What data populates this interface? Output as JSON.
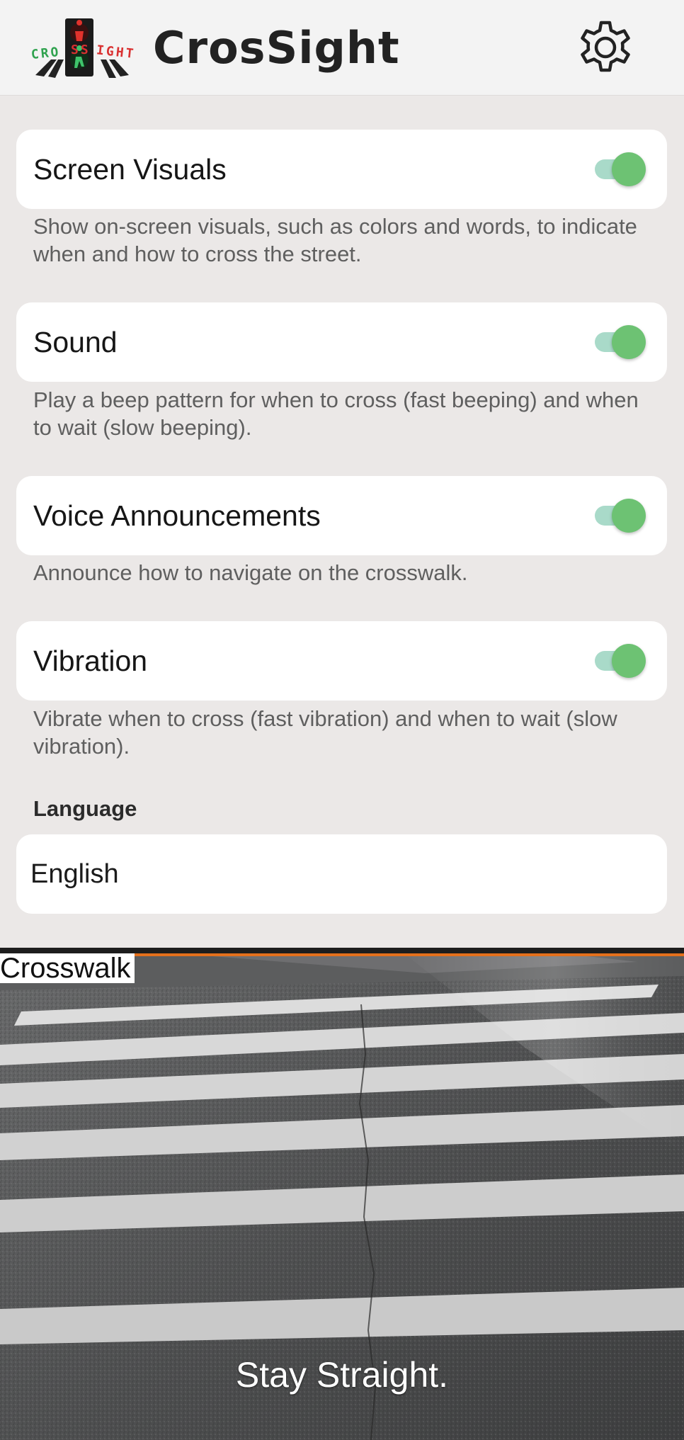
{
  "header": {
    "app_name": "CrosSight",
    "logo_text": "CROSSIGHT",
    "icons": {
      "logo": "traffic-light-logo",
      "settings": "gear-icon"
    }
  },
  "settings": [
    {
      "label": "Screen Visuals",
      "enabled": true,
      "description": "Show on-screen visuals, such as colors and words, to indicate when and how to cross the street."
    },
    {
      "label": "Sound",
      "enabled": true,
      "description": "Play a beep pattern for when to cross (fast beeping) and when to wait (slow beeping)."
    },
    {
      "label": "Voice Announcements",
      "enabled": true,
      "description": "Announce how to navigate on the crosswalk."
    },
    {
      "label": "Vibration",
      "enabled": true,
      "description": "Vibrate when to cross (fast vibration) and when to wait (slow vibration)."
    }
  ],
  "language": {
    "label": "Language",
    "selected": "English"
  },
  "camera": {
    "detection_label": "Crosswalk",
    "instruction": "Stay Straight."
  },
  "colors": {
    "toggle_on_knob": "#6dc273",
    "toggle_on_track": "#a9dac9",
    "detection_border": "#e4701c"
  }
}
